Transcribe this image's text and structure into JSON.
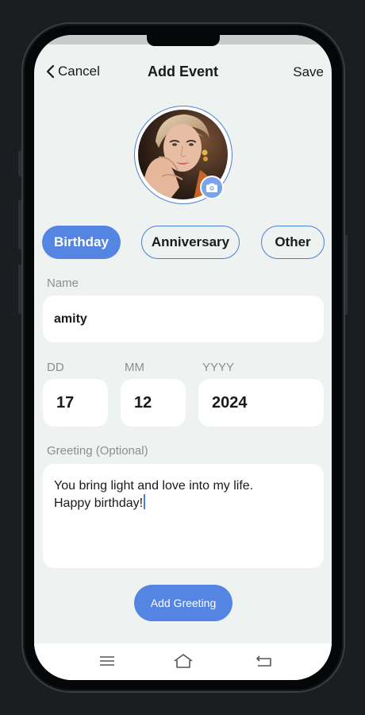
{
  "nav": {
    "cancel_label": "Cancel",
    "title": "Add Event",
    "save_label": "Save"
  },
  "avatar": {
    "icon": "camera-icon"
  },
  "event_types": [
    {
      "label": "Birthday",
      "selected": true
    },
    {
      "label": "Anniversary",
      "selected": false
    },
    {
      "label": "Other",
      "selected": false
    }
  ],
  "name": {
    "label": "Name",
    "value": "amity"
  },
  "date": {
    "day_label": "DD",
    "day_value": "17",
    "month_label": "MM",
    "month_value": "12",
    "year_label": "YYYY",
    "year_value": "2024"
  },
  "greeting": {
    "label": "Greeting (Optional)",
    "value": "You bring light and love into my life.\nHappy birthday!"
  },
  "add_greeting_label": "Add Greeting",
  "bottom_nav": {
    "icons": [
      "menu-icon",
      "home-icon",
      "back-icon"
    ]
  },
  "colors": {
    "accent": "#5585e3",
    "background": "#eef2f1",
    "field": "#ffffff"
  }
}
